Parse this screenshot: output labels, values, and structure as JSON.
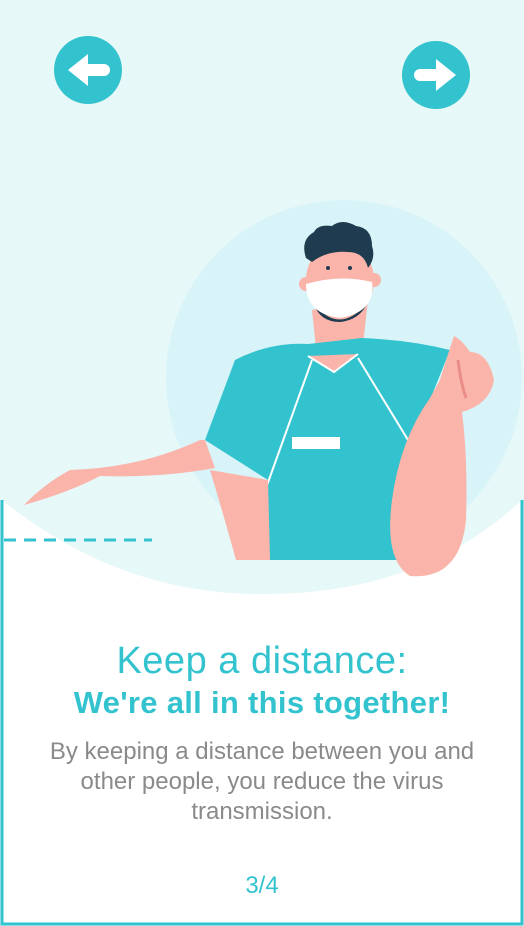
{
  "nav": {
    "back_icon": "arrow-left-icon",
    "next_icon": "arrow-right-icon"
  },
  "content": {
    "title": "Keep a distance:",
    "subtitle": "We're all in this together!",
    "body": "By keeping a distance between you and other people, you reduce the virus transmission.",
    "page_indicator": "3/4"
  },
  "colors": {
    "accent": "#33c3cf",
    "background": "#e6f8f8",
    "body_text": "#8a8a8a",
    "skin": "#fbb4aa"
  }
}
